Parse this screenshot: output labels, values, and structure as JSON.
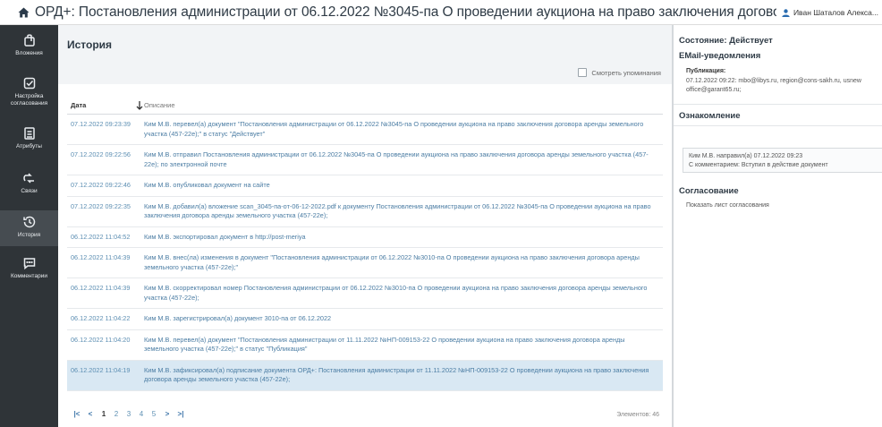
{
  "topbar": {
    "menu_icon": "hamburger-icon",
    "home_icon": "home-icon",
    "title": "ОРД+: Постановления администрации от 06.12.2022 №3045-па О проведении аукциона на право заключения договора аренды земель...",
    "user": "Иван Шаталов Алекса..."
  },
  "sidebar": {
    "items": [
      {
        "label": "Вложения",
        "icon": "attachment-icon"
      },
      {
        "label": "Настройка согласования",
        "icon": "checklist-icon"
      },
      {
        "label": "Атрибуты",
        "icon": "attributes-icon"
      },
      {
        "label": "Связи",
        "icon": "links-icon"
      },
      {
        "label": "История",
        "icon": "history-icon",
        "active": true
      },
      {
        "label": "Комментарии",
        "icon": "comment-icon"
      }
    ]
  },
  "main": {
    "title": "История",
    "mentions_label": "Смотреть упоминания",
    "columns": {
      "date": "Дата",
      "description": "Описание"
    },
    "rows": [
      {
        "date": "07.12.2022 09:23:39",
        "text": "Ким М.В. перевел(а) документ \"Постановления администрации от 06.12.2022 №3045-па О проведении аукциона на право заключения договора аренды земельного участка (457-22е);\" в статус \"Действует\""
      },
      {
        "date": "07.12.2022 09:22:56",
        "text": "Ким М.В. отправил Постановления администрации от 06.12.2022 №3045-па О проведении аукциона на право заключения договора аренды земельного участка (457-22е); по электронной почте"
      },
      {
        "date": "07.12.2022 09:22:46",
        "text": "Ким М.В. опубликовал документ на сайте"
      },
      {
        "date": "07.12.2022 09:22:35",
        "text": "Ким М.В. добавил(а) вложение scan_3045-па-от-06-12-2022.pdf к документу Постановления администрации от 06.12.2022 №3045-па О проведении аукциона на право заключения договора аренды земельного участка (457-22е);"
      },
      {
        "date": "06.12.2022 11:04:52",
        "text": "Ким М.В. экспортировал документ в http://post-meriya"
      },
      {
        "date": "06.12.2022 11:04:39",
        "text": "Ким М.В. внес(ла) изменения в документ \"Постановления администрации от 06.12.2022 №3010-па О проведении аукциона на право заключения договора аренды земельного участка (457-22е);\""
      },
      {
        "date": "06.12.2022 11:04:39",
        "text": "Ким М.В. скорректировал номер Постановления администрации от 06.12.2022 №3010-па О проведении аукциона на право заключения договора аренды земельного участка (457-22е);"
      },
      {
        "date": "06.12.2022 11:04:22",
        "text": "Ким М.В. зарегистрировал(а) документ 3010-па от 06.12.2022"
      },
      {
        "date": "06.12.2022 11:04:20",
        "text": "Ким М.В. перевел(а) документ \"Постановления администрации от 11.11.2022 №НП-009153-22 О проведении аукциона на право заключения договора аренды земельного участка (457-22е);\" в статус \"Публикация\""
      },
      {
        "date": "06.12.2022 11:04:19",
        "text": "Ким М.В. зафиксировал(а) подписание документа ОРД+: Постановления администрации от 11.11.2022 №НП-009153-22 О проведении аукциона на право заключения договора аренды земельного участка (457-22е);",
        "selected": true
      }
    ],
    "pager": {
      "first": "|<",
      "prev": "<",
      "pages": [
        "1",
        "2",
        "3",
        "4",
        "5"
      ],
      "current": "1",
      "next": ">",
      "last": ">|"
    },
    "count_label": "Элементов: 46"
  },
  "right": {
    "state": "Состояние: Действует",
    "email_title": "EMail-уведомления",
    "publication_label": "Публикация:",
    "publication_text": "07.12.2022 09:22: mbo@libys.ru, region@cons-sakh.ru, usnew office@garant65.ru;",
    "review_title": "Ознакомление",
    "review_note_line1": "Ким М.В. направил(а) 07.12.2022 09:23",
    "review_note_line2": "С комментарием: Вступил в действие документ",
    "approval_title": "Согласование",
    "approval_link": "Показать лист согласования"
  },
  "colors": {
    "sidebar_bg": "#2f3438",
    "sidebar_active": "#464c51",
    "link_blue": "#4a7ca3",
    "selected_row": "#d9e8f3",
    "user_icon": "#2a6cb0"
  }
}
